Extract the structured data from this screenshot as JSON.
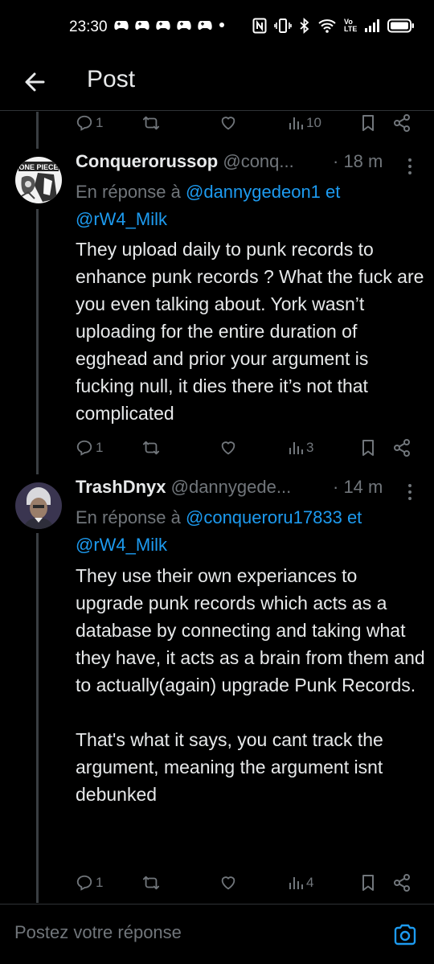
{
  "status_bar": {
    "time": "23:30",
    "icons": [
      "game-controller-icon",
      "game-controller-icon",
      "game-controller-icon",
      "game-controller-icon",
      "game-controller-icon",
      "dot-icon",
      "nfc-icon",
      "vibrate-icon",
      "bluetooth-icon",
      "wifi-icon",
      "volte-icon",
      "signal-icon",
      "battery-icon"
    ],
    "volte_label": "Vo\nLTE"
  },
  "header": {
    "title": "Post",
    "back_icon": "arrow-left-icon"
  },
  "top_actions": {
    "replies": "1",
    "views": "10"
  },
  "tweets": [
    {
      "name": "Conquerorussop",
      "handle": "@conq...",
      "time": "· 18 m",
      "reply_prefix": "En réponse à",
      "mention1": "@dannygedeon1",
      "conj": "et",
      "mention2": "@rW4_Milk",
      "text": "They upload daily to punk records to enhance punk records ? What the fuck are you even talking about. York wasn’t uploading for the entire duration of egghead and prior your argument is fucking null, it dies there it’s not that complicated",
      "replies": "1",
      "views": "3"
    },
    {
      "name": "TrashDnyx",
      "handle": "@dannygede...",
      "time": "· 14 m",
      "reply_prefix": "En réponse à",
      "mention1": "@conqueroru17833",
      "conj": "et",
      "mention2": "@rW4_Milk",
      "text": "They use their own experiances to upgrade punk records which acts as a database by connecting and taking what they have, it acts as a brain from them and to actually(again) upgrade Punk Records.\n\nThat's what it says, you cant track the argument, meaning the argument isnt debunked",
      "replies": "1",
      "views": "4"
    }
  ],
  "composer": {
    "placeholder": "Postez votre réponse"
  },
  "colors": {
    "background": "#000000",
    "accent": "#1d9bf0",
    "text": "#e7e9ea",
    "muted": "#71767b",
    "divider": "#2f3336"
  }
}
